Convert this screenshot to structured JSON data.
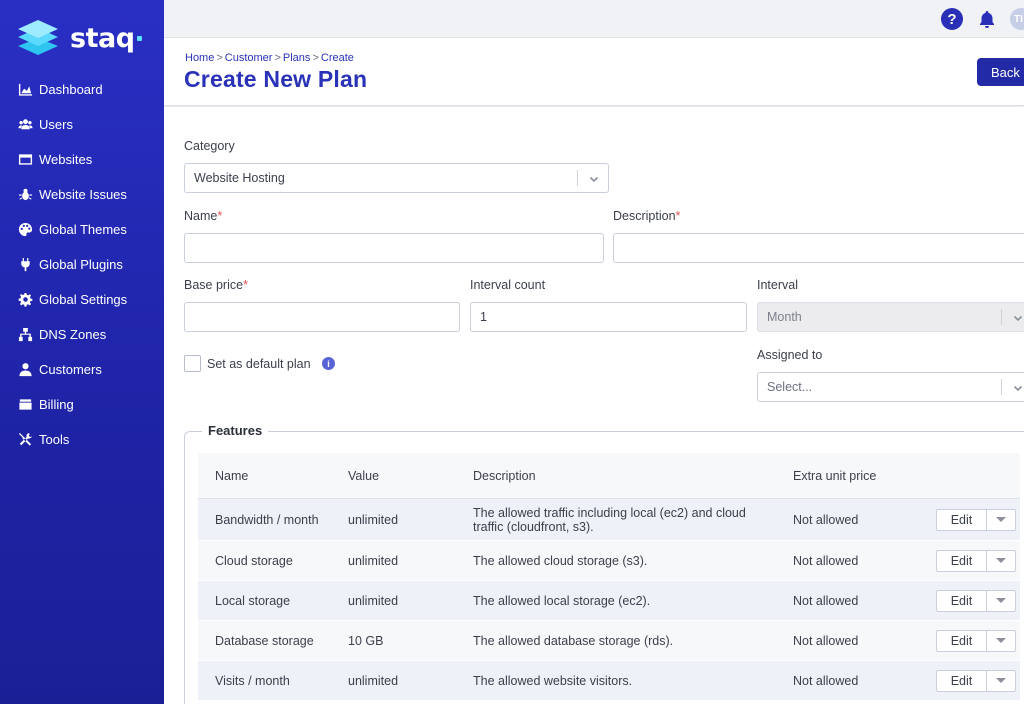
{
  "brand": {
    "name": "staq"
  },
  "nav": [
    {
      "label": "Dashboard",
      "icon": "chart-area-icon"
    },
    {
      "label": "Users",
      "icon": "users-icon"
    },
    {
      "label": "Websites",
      "icon": "window-icon"
    },
    {
      "label": "Website Issues",
      "icon": "bug-icon"
    },
    {
      "label": "Global Themes",
      "icon": "palette-icon"
    },
    {
      "label": "Global Plugins",
      "icon": "plug-icon"
    },
    {
      "label": "Global Settings",
      "icon": "gear-icon"
    },
    {
      "label": "DNS Zones",
      "icon": "network-icon"
    },
    {
      "label": "Customers",
      "icon": "user-icon"
    },
    {
      "label": "Billing",
      "icon": "wallet-icon"
    },
    {
      "label": "Tools",
      "icon": "tools-icon"
    }
  ],
  "topbar": {
    "help": "?",
    "avatar": "TI"
  },
  "header": {
    "breadcrumb": [
      "Home",
      "Customer",
      "Plans",
      "Create"
    ],
    "title": "Create New Plan",
    "back_label": "Back"
  },
  "form": {
    "category_label": "Category",
    "category_value": "Website Hosting",
    "name_label": "Name",
    "description_label": "Description",
    "base_price_label": "Base price",
    "interval_count_label": "Interval count",
    "interval_count_value": "1",
    "interval_label": "Interval",
    "interval_value": "Month",
    "default_plan_label": "Set as default plan",
    "assigned_to_label": "Assigned to",
    "assigned_to_placeholder": "Select..."
  },
  "features": {
    "title": "Features",
    "columns": [
      "Name",
      "Value",
      "Description",
      "Extra unit price"
    ],
    "edit_label": "Edit",
    "rows": [
      {
        "name": "Bandwidth / month",
        "value": "unlimited",
        "description": "The allowed traffic including local (ec2) and cloud traffic (cloudfront, s3).",
        "extra": "Not allowed"
      },
      {
        "name": "Cloud storage",
        "value": "unlimited",
        "description": "The allowed cloud storage (s3).",
        "extra": "Not allowed"
      },
      {
        "name": "Local storage",
        "value": "unlimited",
        "description": "The allowed local storage (ec2).",
        "extra": "Not allowed"
      },
      {
        "name": "Database storage",
        "value": "10 GB",
        "description": "The allowed database storage (rds).",
        "extra": "Not allowed"
      },
      {
        "name": "Visits / month",
        "value": "unlimited",
        "description": "The allowed website visitors.",
        "extra": "Not allowed"
      }
    ]
  }
}
